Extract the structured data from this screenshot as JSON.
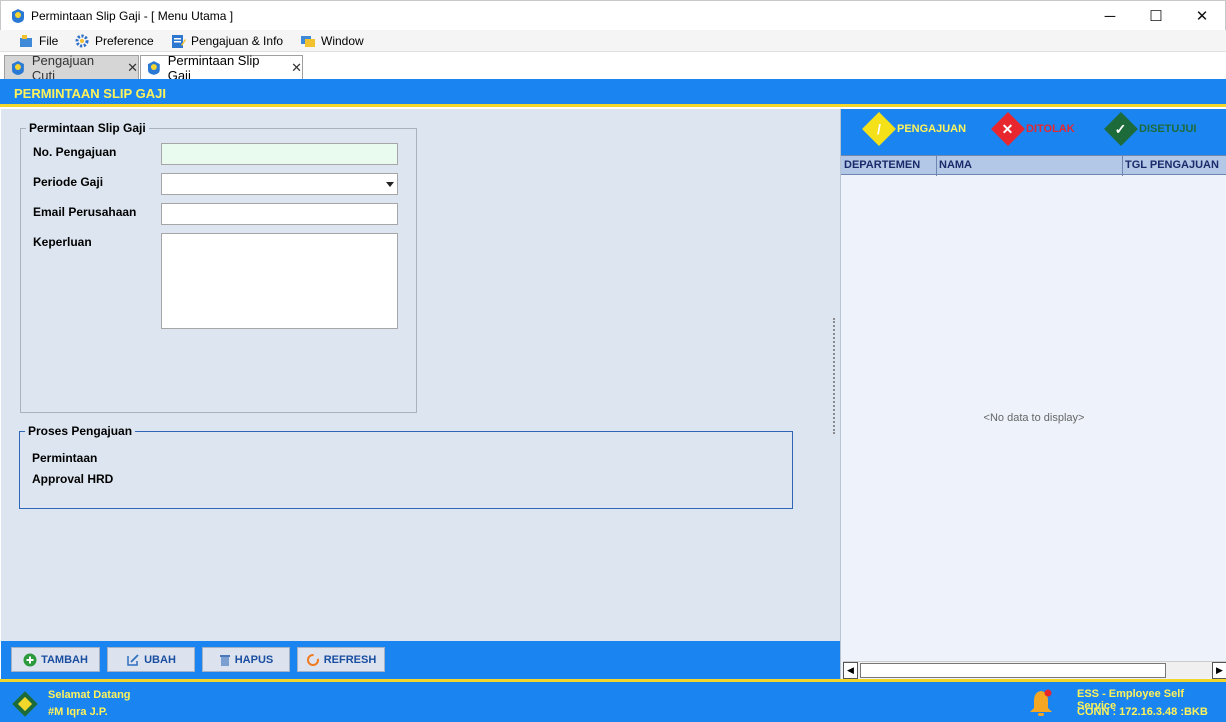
{
  "window": {
    "title": "Permintaan Slip Gaji - [ Menu Utama ]",
    "controls": {
      "minimize": "─",
      "maximize": "☐",
      "close": "✕"
    }
  },
  "menubar": [
    {
      "label": "File",
      "icon": "file-icon"
    },
    {
      "label": "Preference",
      "icon": "gear-icon"
    },
    {
      "label": "Pengajuan & Info",
      "icon": "form-icon"
    },
    {
      "label": "Window",
      "icon": "window-icon"
    }
  ],
  "tabs": [
    {
      "label": "Pengajuan Cuti",
      "active": false,
      "close": "✕"
    },
    {
      "label": "Permintaan Slip Gaji",
      "active": true,
      "close": "✕"
    }
  ],
  "page": {
    "title": "PERMINTAAN SLIP GAJI"
  },
  "form": {
    "group_title": "Permintaan Slip Gaji",
    "fields": {
      "no_pengajuan": {
        "label": "No. Pengajuan",
        "value": ""
      },
      "periode_gaji": {
        "label": "Periode Gaji",
        "value": ""
      },
      "email_perusahaan": {
        "label": "Email Perusahaan",
        "value": ""
      },
      "keperluan": {
        "label": "Keperluan",
        "value": ""
      }
    }
  },
  "proses": {
    "group_title": "Proses Pengajuan",
    "items": [
      "Permintaan",
      "Approval HRD"
    ]
  },
  "status_filters": [
    {
      "label": "PENGAJUAN",
      "color": "#f5e11a",
      "glyph": "/"
    },
    {
      "label": "DITOLAK",
      "color": "#e8262e",
      "glyph": "✕"
    },
    {
      "label": "DISETUJUI",
      "color": "#1d6b3a",
      "glyph": "✓"
    }
  ],
  "grid": {
    "columns": [
      "DEPARTEMEN",
      "NAMA",
      "TGL PENGAJUAN"
    ],
    "empty_text": "<No data to display>"
  },
  "toolbar": {
    "tambah": "TAMBAH",
    "ubah": "UBAH",
    "hapus": "HAPUS",
    "refresh": "REFRESH"
  },
  "footer": {
    "greeting": "Selamat Datang",
    "user": "#M Iqra J.P.",
    "app_name": "ESS - Employee Self Service",
    "connection": "CONN : 172.16.3.48 :BKB"
  },
  "colors": {
    "accent_blue": "#1a85f0",
    "accent_yellow": "#f3d82b",
    "panel_bg": "#dde6f0",
    "label_yellow": "#fff35a"
  }
}
